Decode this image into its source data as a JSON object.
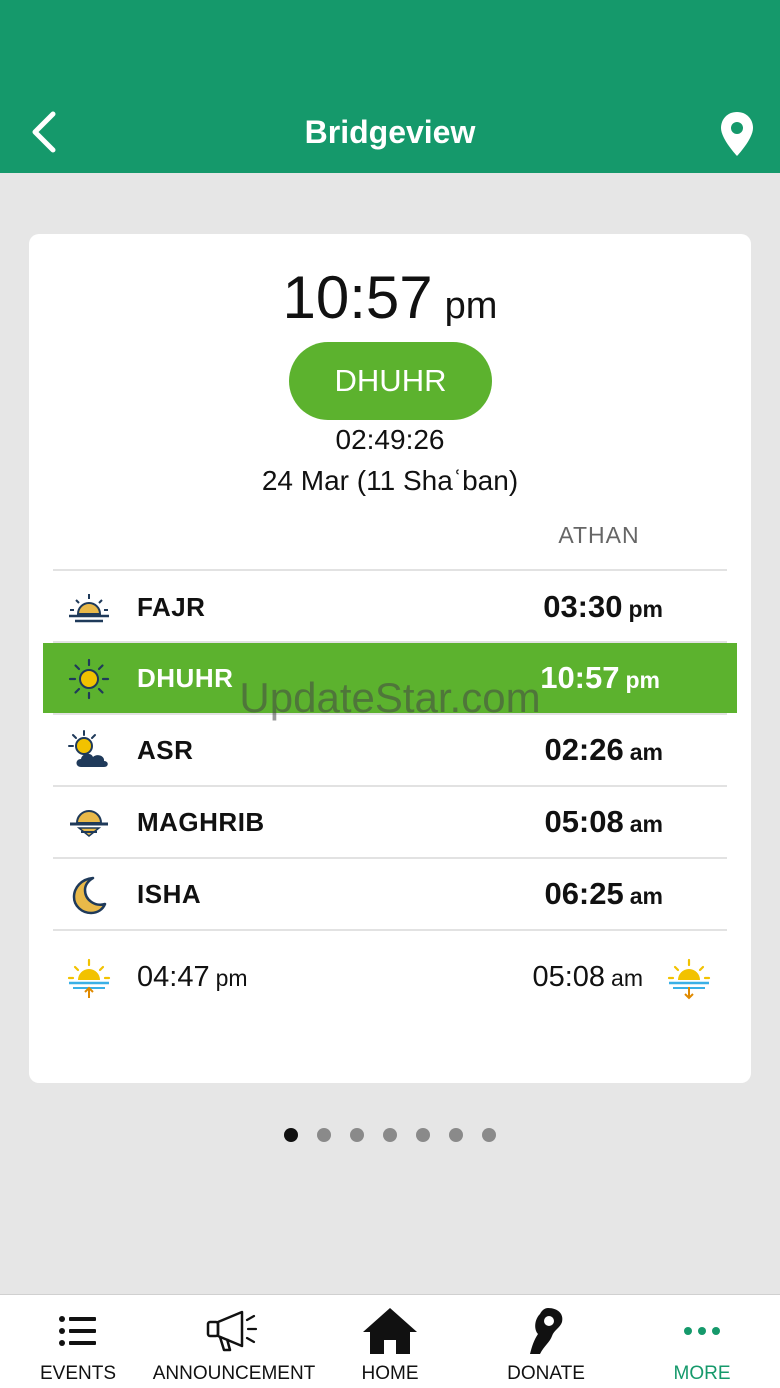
{
  "header": {
    "title": "Bridgeview",
    "bg_color": "#15996b",
    "back_icon": "chevron-left-icon",
    "location_icon": "map-pin-icon"
  },
  "current": {
    "time": "10:57",
    "ampm": "pm",
    "next_prayer": "DHUHR",
    "countdown": "02:49:26",
    "date": "24 Mar (11 Shaʿban)",
    "pill_color": "#5cb22e"
  },
  "table": {
    "column_header": "ATHAN",
    "prayers": [
      {
        "name": "FAJR",
        "time": "03:30",
        "ampm": "pm",
        "icon": "sunrise-horizon-icon"
      },
      {
        "name": "DHUHR",
        "time": "10:57",
        "ampm": "pm",
        "icon": "sun-icon",
        "active": true
      },
      {
        "name": "ASR",
        "time": "02:26",
        "ampm": "am",
        "icon": "sun-cloud-icon"
      },
      {
        "name": "MAGHRIB",
        "time": "05:08",
        "ampm": "am",
        "icon": "sunset-icon"
      },
      {
        "name": "ISHA",
        "time": "06:25",
        "ampm": "am",
        "icon": "crescent-moon-icon"
      }
    ],
    "sunrise": {
      "time": "04:47",
      "ampm": "pm",
      "icon": "sunrise-icon"
    },
    "sunset": {
      "time": "05:08",
      "ampm": "am",
      "icon": "sunset-down-icon"
    }
  },
  "pager": {
    "count": 7,
    "active_index": 0
  },
  "watermark": "UpdateStar.com",
  "tabs": [
    {
      "label": "EVENTS",
      "icon": "list-icon"
    },
    {
      "label": "ANNOUNCEMENT",
      "icon": "megaphone-icon"
    },
    {
      "label": "HOME",
      "icon": "home-icon"
    },
    {
      "label": "DONATE",
      "icon": "donate-hand-icon"
    },
    {
      "label": "MORE",
      "icon": "more-dots-icon",
      "active": true
    }
  ]
}
